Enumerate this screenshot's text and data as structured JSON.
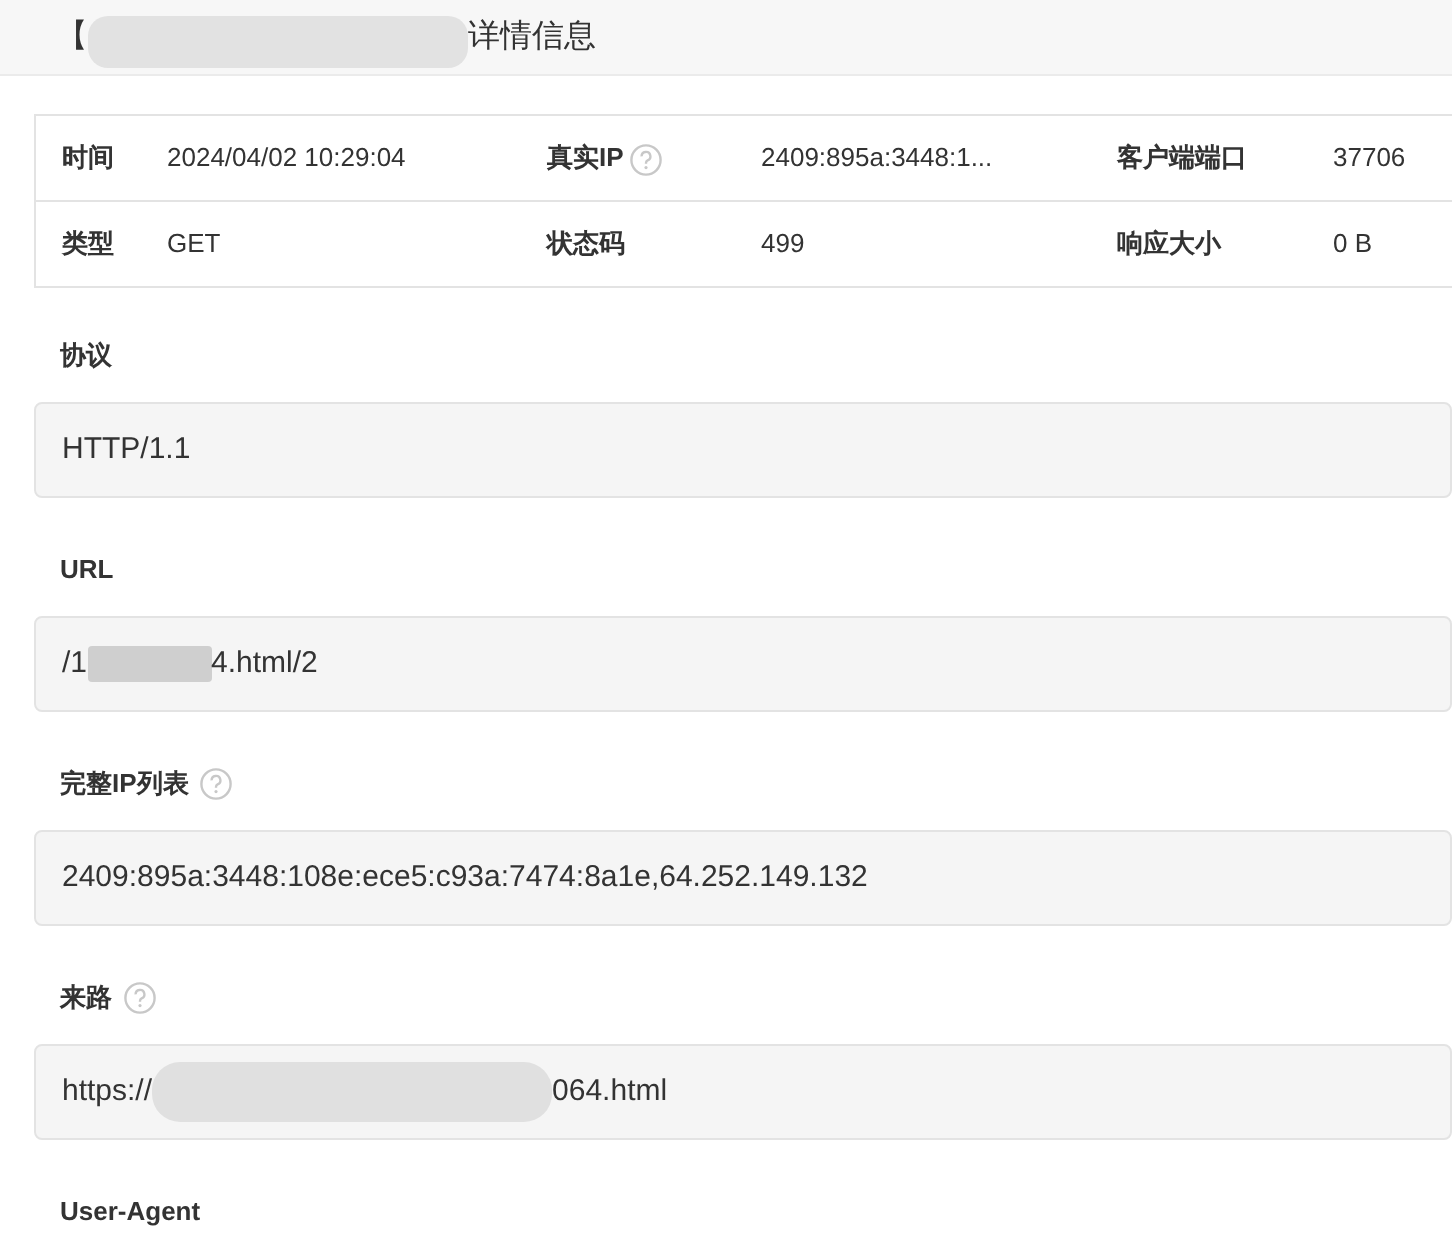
{
  "header": {
    "title_parts": [
      {
        "kind": "text",
        "text": "【"
      },
      {
        "kind": "redacted"
      },
      {
        "kind": "text",
        "text": "详情信息"
      }
    ]
  },
  "summary_table": {
    "rows": [
      [
        {
          "label": "时间",
          "help": false,
          "value": "2024/04/02 10:29:04"
        },
        {
          "label": "真实IP",
          "help": true,
          "value": "2409:895a:3448:1..."
        },
        {
          "label": "客户端端口",
          "help": false,
          "value": "37706"
        }
      ],
      [
        {
          "label": "类型",
          "help": false,
          "value": "GET"
        },
        {
          "label": "状态码",
          "help": false,
          "value": "499"
        },
        {
          "label": "响应大小",
          "help": false,
          "value": "0 B"
        }
      ]
    ]
  },
  "sections": [
    {
      "label": "协议",
      "help": false,
      "value_parts": [
        {
          "kind": "text",
          "text": "HTTP/1.1"
        }
      ]
    },
    {
      "label": "URL",
      "help": false,
      "value_parts": [
        {
          "kind": "text",
          "text": "/1"
        },
        {
          "kind": "redacted"
        },
        {
          "kind": "text",
          "text": "4.html/2"
        }
      ]
    },
    {
      "label": "完整IP列表",
      "help": true,
      "value_parts": [
        {
          "kind": "text",
          "text": "2409:895a:3448:108e:ece5:c93a:7474:8a1e,64.252.149.132"
        }
      ]
    },
    {
      "label": "来路",
      "help": true,
      "value_parts": [
        {
          "kind": "text",
          "text": "https://"
        },
        {
          "kind": "redacted"
        },
        {
          "kind": "text",
          "text": "064.html"
        }
      ]
    },
    {
      "label": "User-Agent",
      "help": false
    }
  ]
}
